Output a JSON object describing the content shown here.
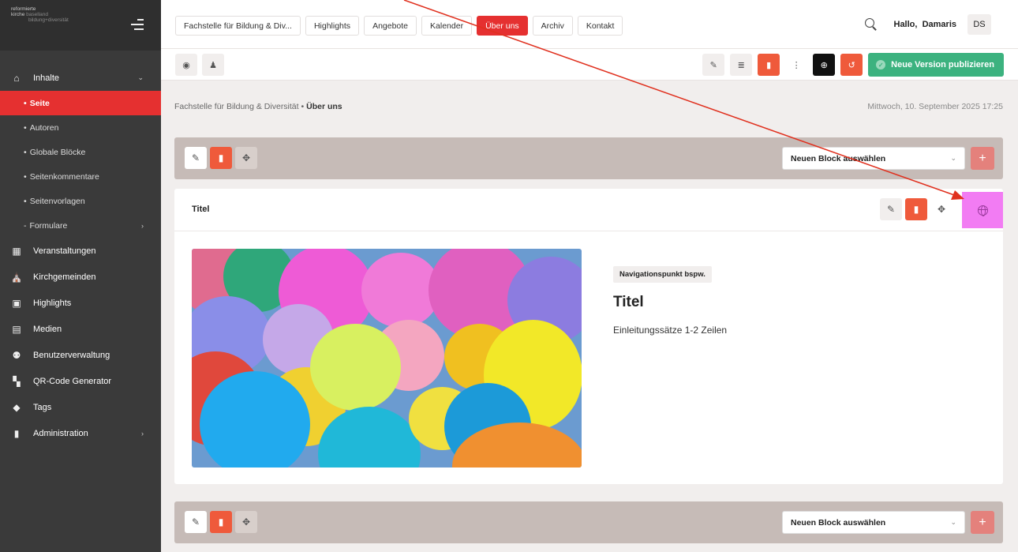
{
  "brand": {
    "line1": "reformierte",
    "line2": "kirche",
    "line2b": "baselland",
    "line3": "bildung+diversität"
  },
  "sidebar": {
    "items": [
      {
        "label": "Inhalte",
        "icon": "home-icon"
      },
      {
        "label": "Seite"
      },
      {
        "label": "Autoren"
      },
      {
        "label": "Globale Blöcke"
      },
      {
        "label": "Seitenkommentare"
      },
      {
        "label": "Seitenvorlagen"
      },
      {
        "label": "Formulare"
      },
      {
        "label": "Veranstaltungen",
        "icon": "calendar-icon"
      },
      {
        "label": "Kirchgemeinden",
        "icon": "church-icon"
      },
      {
        "label": "Highlights",
        "icon": "image-frame-icon"
      },
      {
        "label": "Medien",
        "icon": "media-icon"
      },
      {
        "label": "Benutzerverwaltung",
        "icon": "users-icon"
      },
      {
        "label": "QR-Code Generator",
        "icon": "qr-code-icon"
      },
      {
        "label": "Tags",
        "icon": "tag-icon"
      },
      {
        "label": "Administration",
        "icon": "clipboard-icon"
      }
    ]
  },
  "header": {
    "tabs": [
      "Fachstelle für Bildung & Div...",
      "Highlights",
      "Angebote",
      "Kalender",
      "Über uns",
      "Archiv",
      "Kontakt"
    ],
    "active_tab": "Über uns",
    "greeting": "Hallo,",
    "user_name": "Damaris",
    "initials": "DS"
  },
  "toolbar": {
    "publish_label": "Neue Version publizieren"
  },
  "breadcrumb": {
    "parent": "Fachstelle für Bildung & Diversität",
    "separator": "•",
    "current": "Über uns"
  },
  "date": "Mittwoch, 10. September 2025 17:25",
  "block_select": {
    "label": "Neuen Block auswählen"
  },
  "block": {
    "title": "Titel",
    "badge": "Navigationspunkt bspw.",
    "heading": "Titel",
    "intro": "Einleitungssätze 1-2 Zeilen"
  },
  "colors": {
    "accent": "#e53030",
    "publish": "#3cb27f",
    "highlight": "#f27cf3"
  }
}
